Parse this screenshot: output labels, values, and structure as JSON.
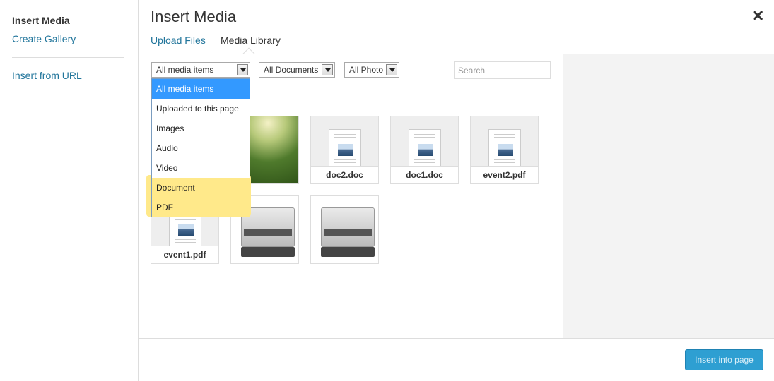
{
  "sidebar": {
    "active": "Insert Media",
    "links": [
      "Create Gallery",
      "Insert from URL"
    ]
  },
  "header": {
    "title": "Insert Media",
    "close_symbol": "✕",
    "tabs": [
      "Upload Files",
      "Media Library"
    ]
  },
  "filters": {
    "media_type": "All media items",
    "documents": "All Documents",
    "photo": "All Photo",
    "search_placeholder": "Search",
    "media_options": [
      {
        "label": "All media items",
        "selected": true,
        "highlighted": false
      },
      {
        "label": "Uploaded to this page",
        "selected": false,
        "highlighted": false
      },
      {
        "label": "Images",
        "selected": false,
        "highlighted": false
      },
      {
        "label": "Audio",
        "selected": false,
        "highlighted": false
      },
      {
        "label": "Video",
        "selected": false,
        "highlighted": false
      },
      {
        "label": "Document",
        "selected": false,
        "highlighted": true
      },
      {
        "label": "PDF",
        "selected": false,
        "highlighted": true
      }
    ]
  },
  "media": [
    {
      "caption": "",
      "kind": "image-forest"
    },
    {
      "caption": "doc2.doc",
      "kind": "document"
    },
    {
      "caption": "doc1.doc",
      "kind": "document"
    },
    {
      "caption": "event2.pdf",
      "kind": "document"
    },
    {
      "caption": "event1.pdf",
      "kind": "document"
    },
    {
      "caption": "",
      "kind": "image-printer"
    },
    {
      "caption": "",
      "kind": "image-printer"
    }
  ],
  "footer": {
    "insert_label": "Insert into page"
  },
  "colors": {
    "link": "#21759b",
    "dropdown_selected": "#3399ff",
    "highlight": "#ffe98a",
    "primary_button": "#2e9fd2"
  }
}
